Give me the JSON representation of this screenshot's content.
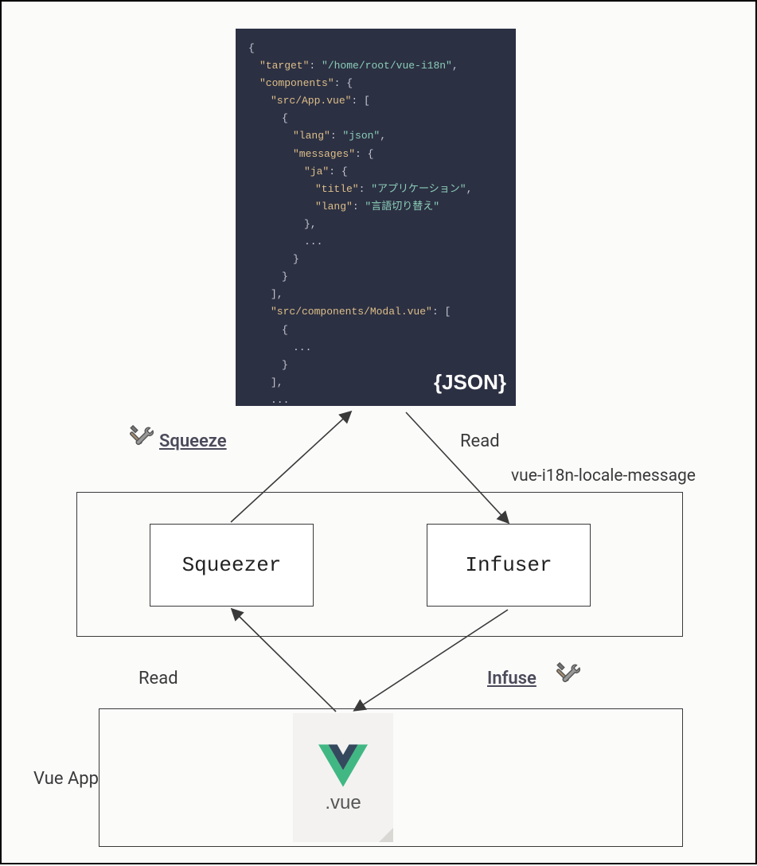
{
  "json_preview": {
    "target_key": "\"target\"",
    "target_val": "\"/home/root/vue-i18n\"",
    "components_key": "\"components\"",
    "src_app_key": "\"src/App.vue\"",
    "lang_key": "\"lang\"",
    "lang_val": "\"json\"",
    "messages_key": "\"messages\"",
    "ja_key": "\"ja\"",
    "title_key": "\"title\"",
    "title_val": "\"アプリケーション\"",
    "langfield_key": "\"lang\"",
    "langfield_val": "\"言語切り替え\"",
    "src_modal_key": "\"src/components/Modal.vue\"",
    "ellipsis": "...",
    "overlay_label": "{JSON}"
  },
  "boxes": {
    "squeezer": "Squeezer",
    "infuser": "Infuser"
  },
  "labels": {
    "squeeze": "Squeeze",
    "read_top": "Read",
    "package_name": "vue-i18n-locale-message",
    "read_bottom": "Read",
    "infuse": "Infuse",
    "vue_app": "Vue App"
  },
  "vue_file": {
    "ext": ".vue"
  }
}
